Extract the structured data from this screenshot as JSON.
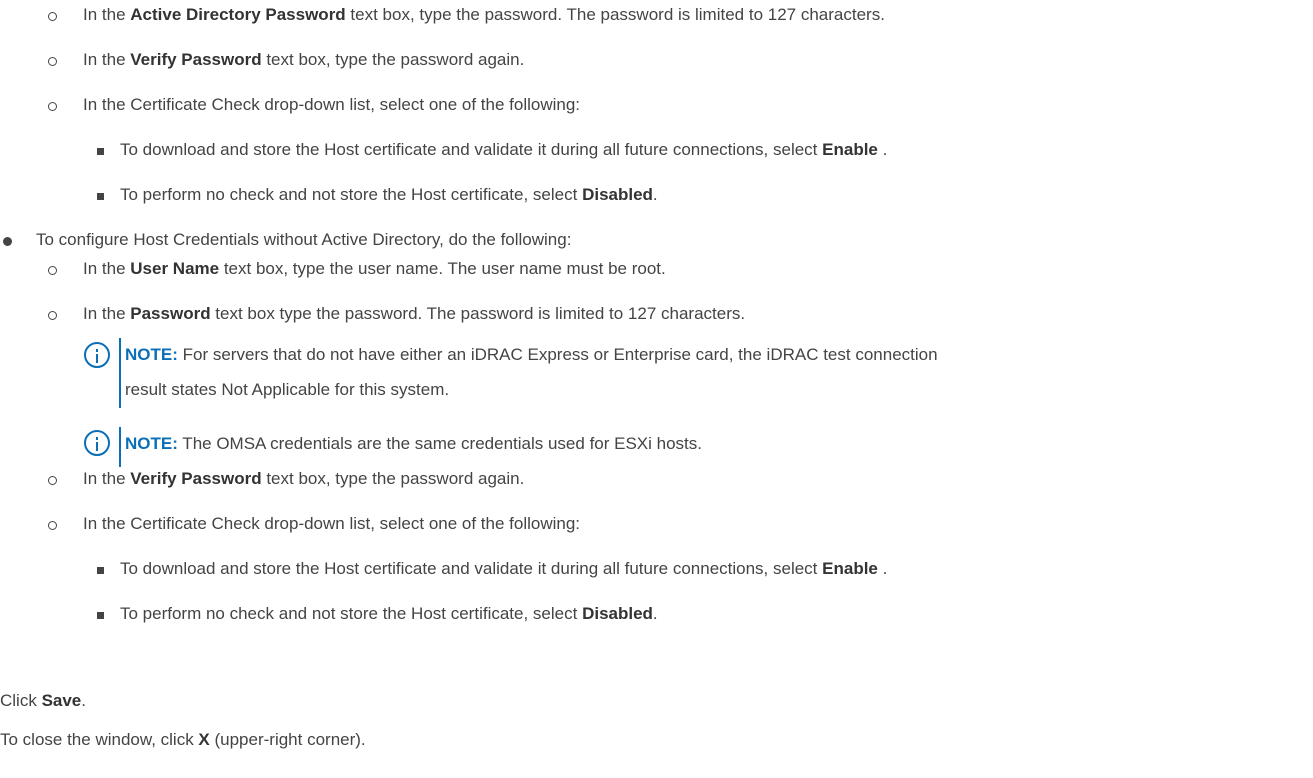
{
  "colors": {
    "text": "#444444",
    "note_accent": "#0b6fb8"
  },
  "ad_section": {
    "item1": {
      "pre": "In the ",
      "bold": "Active Directory Password",
      "post": " text box, type the password. The password is limited to 127 characters."
    },
    "item2": {
      "pre": "In the ",
      "bold": "Verify Password",
      "post": " text box, type the password again."
    },
    "item3": {
      "text": "In the Certificate Check drop-down list, select one of the following:"
    },
    "sub1": {
      "pre": "To download and store the Host certificate and validate it during all future connections, select ",
      "bold": "Enable",
      "post": " ."
    },
    "sub2": {
      "pre": "To perform no check and not store the Host certificate, select ",
      "bold": "Disabled",
      "post": "."
    }
  },
  "no_ad_section": {
    "heading": "To configure Host Credentials without Active Directory, do the following:",
    "item1": {
      "pre": "In the ",
      "bold": "User Name",
      "post": " text box, type the user name. The user name must be root."
    },
    "item2": {
      "pre": "In the ",
      "bold": "Password",
      "post": " text box type the password. The password is limited to 127 characters."
    },
    "note1": {
      "label": "NOTE:",
      "line1": " For servers that do not have either an iDRAC Express or Enterprise card, the iDRAC test connection",
      "line2": "result states Not Applicable for this system."
    },
    "note2": {
      "label": "NOTE:",
      "text": " The OMSA credentials are the same credentials used for ESXi hosts."
    },
    "item3": {
      "pre": "In the ",
      "bold": "Verify Password",
      "post": " text box, type the password again."
    },
    "item4": {
      "text": "In the Certificate Check drop-down list, select one of the following:"
    },
    "sub1": {
      "pre": "To download and store the Host certificate and validate it during all future connections, select ",
      "bold": "Enable",
      "post": " ."
    },
    "sub2": {
      "pre": "To perform no check and not store the Host certificate, select ",
      "bold": "Disabled",
      "post": "."
    }
  },
  "steps": {
    "save": {
      "pre": "Click ",
      "bold": "Save",
      "post": "."
    },
    "close": {
      "pre": "To close the window, click ",
      "bold": "X",
      "post": " (upper-right corner)."
    }
  }
}
